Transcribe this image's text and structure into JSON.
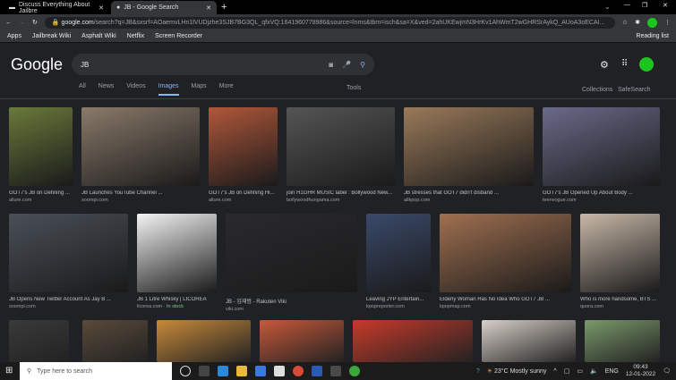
{
  "browser": {
    "tabs": [
      {
        "title": "Discuss Everything About Jailbre"
      },
      {
        "title": "JB - Google Search"
      }
    ],
    "url_domain": "google.com",
    "url_rest": "/search?q=JB&sxsrf=AOaemvLHn1lVUDjzhe3SJB7BG3QL_qfxVQ:1641960778986&source=lnms&tbm=isch&sa=X&ved=2ahUKEwjmN3HrKv1AhWmT2wGHRSrAykQ_AUoA3oECAI...",
    "bookmarks": [
      "Apps",
      "Jailbreak Wiki",
      "Asphalt Wiki",
      "Netflix",
      "Screen Recorder"
    ],
    "reading_list": "Reading list"
  },
  "google": {
    "logo": "Google",
    "query": "JB",
    "nav": [
      "All",
      "News",
      "Videos",
      "Images",
      "Maps",
      "More"
    ],
    "tools": "Tools",
    "collections": "Collections",
    "safesearch": "SafeSearch"
  },
  "results": [
    {
      "caption": "GOT7's JB on Defining ...",
      "source": "allure.com",
      "color": "#6a7a3a"
    },
    {
      "caption": "JB Launches YouTube Channel ...",
      "source": "soompi.com",
      "color": "#8a7a6a"
    },
    {
      "caption": "GOT7's JB on Defining Hi...",
      "source": "allure.com",
      "color": "#b0583a"
    },
    {
      "caption": "join H1GHR MUSIC label : Bollywood New...",
      "source": "bollywoodhungama.com",
      "color": "#555"
    },
    {
      "caption": "JB stresses that GOT7 didn't disband ...",
      "source": "allkpop.com",
      "color": "#9a7a5a"
    },
    {
      "caption": "GOT7's JB Opened Up About Body ...",
      "source": "teenvogue.com",
      "color": "#6a6a8a"
    },
    {
      "caption": "JB Opens New Twitter Account As Jay B ...",
      "source": "soompi.com",
      "color": "#4a5058"
    },
    {
      "caption": "JB 1 Litre Whisky | LICOREA",
      "source": "licorea.com",
      "stock": "In stock",
      "color": "#f4f4f4"
    },
    {
      "caption": "JB - 임재범 - Rakuten Viki",
      "source": "viki.com",
      "color": "#2a2a2e"
    },
    {
      "caption": "Leaving JYP Entertain...",
      "source": "kpopreporter.com",
      "color": "#3a4a6a"
    },
    {
      "caption": "Elderly Woman Has No Idea Who GOT7 JB ...",
      "source": "kpopmap.com",
      "color": "#a07050"
    },
    {
      "caption": "Who is more handsome, BTS ...",
      "source": "quora.com",
      "color": "#c8b8a8"
    }
  ],
  "row3_colors": [
    "#3a3a3a",
    "#5a4a3a",
    "#c88a3a",
    "#c8583a",
    "#c83a2a",
    "#d8d0c8",
    "#7a9a6a"
  ],
  "taskbar": {
    "search_placeholder": "Type here to search",
    "weather": "23°C  Mostly sunny",
    "lang": "ENG",
    "time": "09:43",
    "date": "12-01-2022"
  }
}
